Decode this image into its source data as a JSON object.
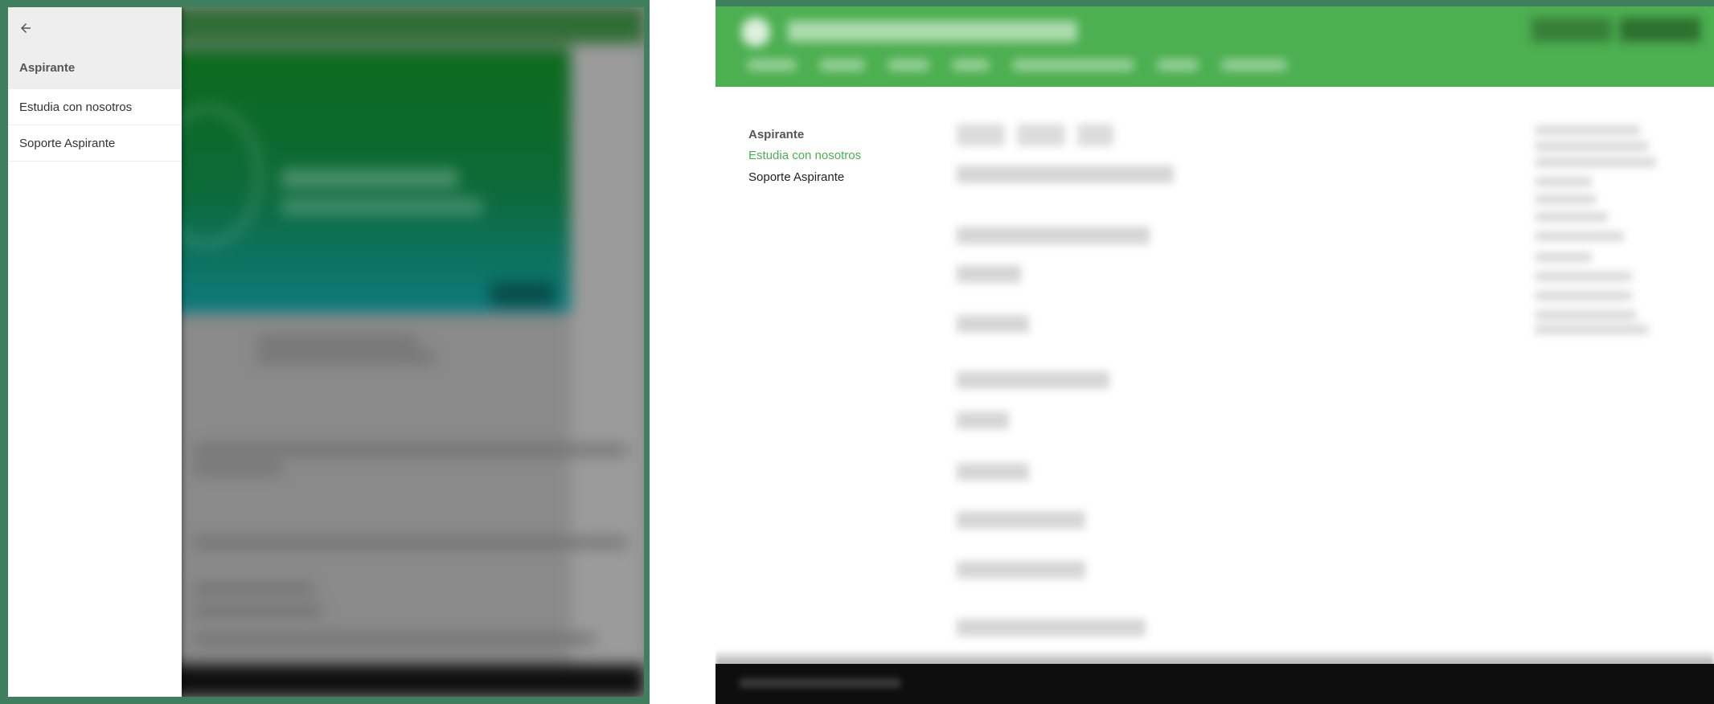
{
  "mobile": {
    "drawer": {
      "back_icon": "arrow-left-icon",
      "title": "Aspirante",
      "items": [
        {
          "label": "Estudia con nosotros"
        },
        {
          "label": "Soporte Aspirante"
        }
      ]
    }
  },
  "desktop": {
    "menu": {
      "title": "Aspirante",
      "items": [
        {
          "label": "Estudia con nosotros",
          "active": true
        },
        {
          "label": "Soporte Aspirante",
          "active": false
        }
      ]
    }
  },
  "colors": {
    "brand_green": "#4caf50",
    "frame_green": "#3f7f5e",
    "drawer_header_bg": "#eeeeee",
    "footer_bg": "#0e0e0e"
  }
}
